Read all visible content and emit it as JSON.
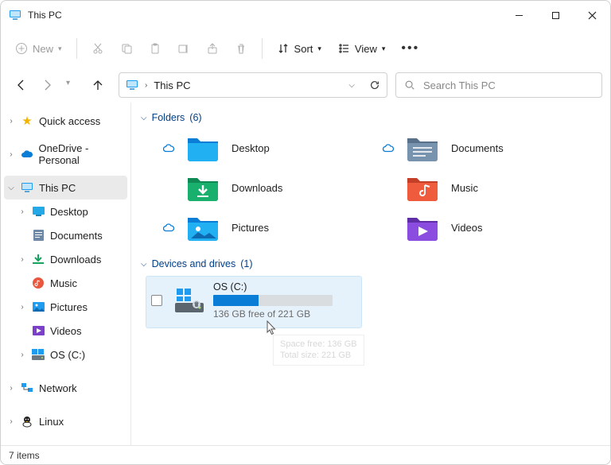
{
  "window": {
    "title": "This PC"
  },
  "toolbar": {
    "new_label": "New",
    "sort_label": "Sort",
    "view_label": "View"
  },
  "breadcrumb": {
    "current": "This PC"
  },
  "search": {
    "placeholder": "Search This PC"
  },
  "sidebar": {
    "items": [
      {
        "label": "Quick access"
      },
      {
        "label": "OneDrive - Personal"
      },
      {
        "label": "This PC"
      },
      {
        "label": "Desktop"
      },
      {
        "label": "Documents"
      },
      {
        "label": "Downloads"
      },
      {
        "label": "Music"
      },
      {
        "label": "Pictures"
      },
      {
        "label": "Videos"
      },
      {
        "label": "OS (C:)"
      },
      {
        "label": "Network"
      },
      {
        "label": "Linux"
      }
    ]
  },
  "groups": {
    "folders": {
      "label": "Folders",
      "count": "(6)"
    },
    "drives": {
      "label": "Devices and drives",
      "count": "(1)"
    }
  },
  "folders": [
    {
      "label": "Desktop",
      "cloud": true
    },
    {
      "label": "Documents",
      "cloud": true
    },
    {
      "label": "Downloads",
      "cloud": false
    },
    {
      "label": "Music",
      "cloud": false
    },
    {
      "label": "Pictures",
      "cloud": true
    },
    {
      "label": "Videos",
      "cloud": false
    }
  ],
  "drive": {
    "name": "OS (C:)",
    "free_text": "136 GB free of 221 GB",
    "fill_percent": 38,
    "tooltip_line1": "Space free: 136 GB",
    "tooltip_line2": "Total size: 221 GB"
  },
  "status": {
    "text": "7 items"
  }
}
